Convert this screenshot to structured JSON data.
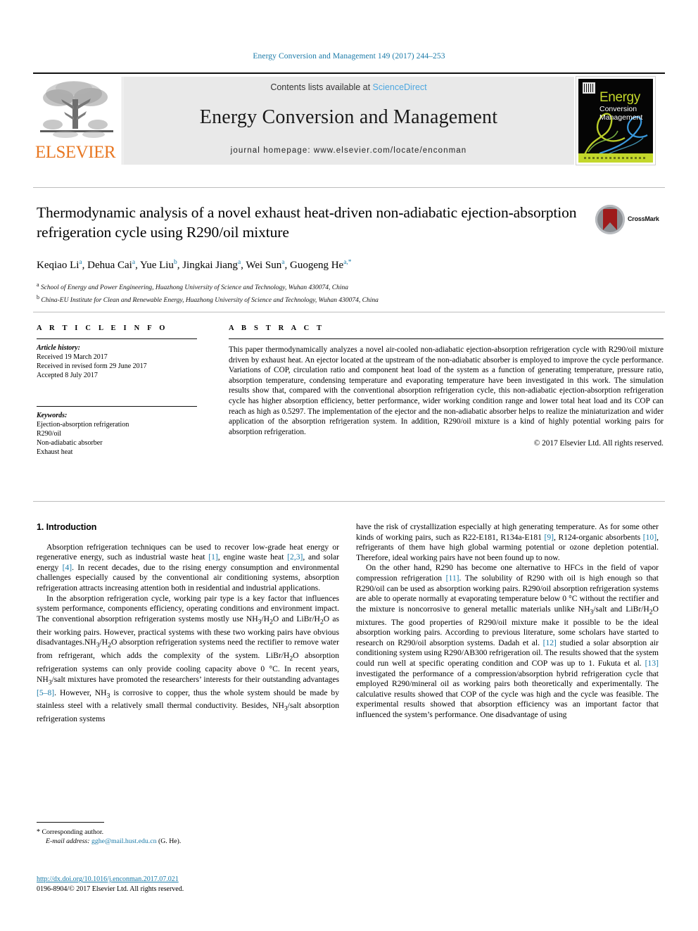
{
  "running_head": "Energy Conversion and Management 149 (2017) 244–253",
  "masthead": {
    "publisher": "ELSEVIER",
    "contents_prefix": "Contents lists available at ",
    "contents_link": "ScienceDirect",
    "journal_title": "Energy Conversion and Management",
    "homepage": "journal homepage: www.elsevier.com/locate/enconman",
    "cover": {
      "title": "Energy",
      "sub1": "Conversion",
      "sub2": "Management"
    }
  },
  "article": {
    "title": "Thermodynamic analysis of a novel exhaust heat-driven non-adiabatic ejection-absorption refrigeration cycle using R290/oil mixture",
    "crossmark_label": "CrossMark",
    "affiliations": [
      "School of Energy and Power Engineering, Huazhong University of Science and Technology, Wuhan 430074, China",
      "China-EU Institute for Clean and Renewable Energy, Huazhong University of Science and Technology, Wuhan 430074, China"
    ]
  },
  "info": {
    "heading": "A R T I C L E  I N F O",
    "history_label": "Article history:",
    "history": [
      "Received 19 March 2017",
      "Received in revised form 29 June 2017",
      "Accepted 8 July 2017"
    ],
    "keywords_label": "Keywords:",
    "keywords": [
      "Ejection-absorption refrigeration",
      "R290/oil",
      "Non-adiabatic absorber",
      "Exhaust heat"
    ]
  },
  "abstract": {
    "heading": "A B S T R A C T",
    "text": "This paper thermodynamically analyzes a novel air-cooled non-adiabatic ejection-absorption refrigeration cycle with R290/oil mixture driven by exhaust heat. An ejector located at the upstream of the non-adiabatic absorber is employed to improve the cycle performance. Variations of COP, circulation ratio and component heat load of the system as a function of generating temperature, pressure ratio, absorption temperature, condensing temperature and evaporating temperature have been investigated in this work. The simulation results show that, compared with the conventional absorption refrigeration cycle, this non-adiabatic ejection-absorption refrigeration cycle has higher absorption efficiency, better performance, wider working condition range and lower total heat load and its COP can reach as high as 0.5297. The implementation of the ejector and the non-adiabatic absorber helps to realize the miniaturization and wider application of the absorption refrigeration system. In addition, R290/oil mixture is a kind of highly potential working pairs for absorption refrigeration.",
    "copyright": "© 2017 Elsevier Ltd. All rights reserved."
  },
  "body": {
    "section_heading": "1. Introduction"
  },
  "footnote": {
    "corresponding": "Corresponding author.",
    "email_label": "E-mail address:",
    "email": "gghe@mail.hust.edu.cn",
    "email_suffix": "(G. He)."
  },
  "footer": {
    "doi": "http://dx.doi.org/10.1016/j.enconman.2017.07.021",
    "issn_line": "0196-8904/© 2017 Elsevier Ltd. All rights reserved."
  },
  "colors": {
    "link": "#1a7aa8",
    "sciencedirect": "#4da7e0",
    "elsevier_orange": "#e87722",
    "crossmark_red": "#9e1b1b"
  }
}
